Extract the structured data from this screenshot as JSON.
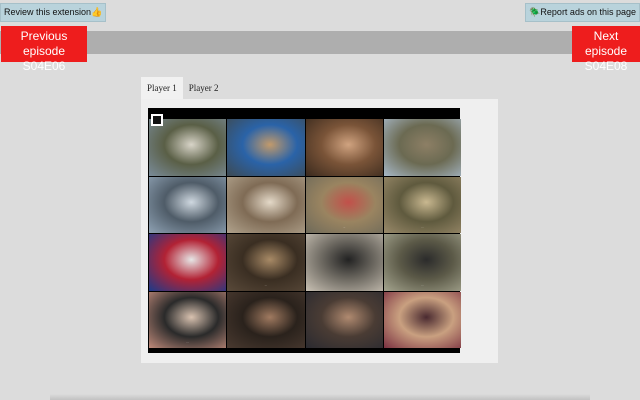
{
  "top_bar": {
    "review_label": "Review this extension",
    "review_emoji": "👍",
    "report_label": "Report ads on this page",
    "report_emoji": "🪲"
  },
  "navigation": {
    "prev_line1": "Previous episode",
    "prev_line2": "S04E06",
    "next_line1": "Next episode",
    "next_line2": "S04E08"
  },
  "player": {
    "tabs": [
      {
        "label": "Player 1",
        "active": true
      },
      {
        "label": "Player 2",
        "active": false
      }
    ]
  },
  "thumbnail_grid": {
    "cells": [
      {
        "colors": [
          "#7a8c9a",
          "#5a5f46",
          "#d8d4c8"
        ],
        "caption": ""
      },
      {
        "colors": [
          "#3e4a52",
          "#2a63a8",
          "#c29a6b"
        ],
        "caption": ""
      },
      {
        "colors": [
          "#3a2a1e",
          "#7a5438",
          "#d0a380"
        ],
        "caption": ""
      },
      {
        "colors": [
          "#a7b8c8",
          "#6b6a52",
          "#8d7f65"
        ],
        "caption": ""
      },
      {
        "colors": [
          "#8fa2b4",
          "#4f5c68",
          "#cfd8e0"
        ],
        "caption": ""
      },
      {
        "colors": [
          "#b1a38d",
          "#7f6b55",
          "#e4d9c8"
        ],
        "caption": ""
      },
      {
        "colors": [
          "#6e6a5a",
          "#9a8460",
          "#c2504a"
        ],
        "caption": "..."
      },
      {
        "colors": [
          "#9a8a6a",
          "#5f5a3e",
          "#c9b890"
        ],
        "caption": "..."
      },
      {
        "colors": [
          "#1b3a8a",
          "#b22234",
          "#e6e6e6"
        ],
        "caption": ""
      },
      {
        "colors": [
          "#5a4a3a",
          "#3a2e22",
          "#a88a66"
        ],
        "caption": "..."
      },
      {
        "colors": [
          "#c9c1b4",
          "#6e6a62",
          "#222222"
        ],
        "caption": ""
      },
      {
        "colors": [
          "#a5a58f",
          "#5c5a48",
          "#2b2b2b"
        ],
        "caption": "..."
      },
      {
        "colors": [
          "#c08a7a",
          "#2a2a2a",
          "#d9c2b0"
        ],
        "caption": "..."
      },
      {
        "colors": [
          "#4a3a30",
          "#2a221c",
          "#a07a60"
        ],
        "caption": ""
      },
      {
        "colors": [
          "#2a2a30",
          "#4a3c34",
          "#b08a70"
        ],
        "caption": ""
      },
      {
        "colors": [
          "#7a3040",
          "#c9a080",
          "#4a2a30"
        ],
        "caption": ""
      }
    ]
  }
}
